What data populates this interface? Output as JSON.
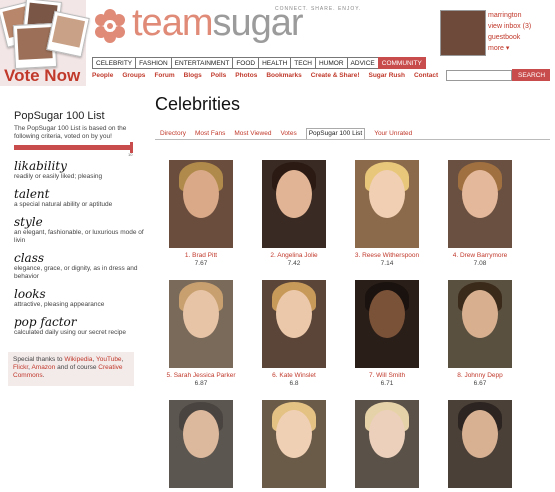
{
  "header": {
    "logo_prefix": "team",
    "logo_suffix": "sugar",
    "tagline": "CONNECT. SHARE. ENJOY.",
    "vote_now": "Vote Now",
    "categories": [
      "CELEBRITY",
      "FASHION",
      "ENTERTAINMENT",
      "FOOD",
      "HEALTH",
      "TECH",
      "HUMOR",
      "ADVICE",
      "COMMUNITY"
    ],
    "active_category": "COMMUNITY",
    "subnav": [
      "People",
      "Groups",
      "Forum",
      "Blogs",
      "Polls",
      "Photos",
      "Bookmarks",
      "Create & Share!",
      "Sugar Rush",
      "Contact"
    ],
    "user": {
      "username": "marrington",
      "inbox": "view inbox (3)",
      "guestbook": "guestbook",
      "more": "more ▾"
    },
    "search": {
      "button": "SEARCH",
      "value": ""
    }
  },
  "sidebar": {
    "title": "PopSugar 100 List",
    "description": "The PopSugar 100 List is based on the following criteria, voted on by you!",
    "slider_label": "10",
    "criteria": [
      {
        "title": "likability",
        "desc": "readily or easily liked; pleasing"
      },
      {
        "title": "talent",
        "desc": "a special natural ability or aptitude"
      },
      {
        "title": "style",
        "desc": "an elegant, fashionable, or luxurious mode of livin"
      },
      {
        "title": "class",
        "desc": "elegance, grace, or dignity, as in dress and behavior"
      },
      {
        "title": "looks",
        "desc": "attractive, pleasing appearance"
      },
      {
        "title": "pop factor",
        "desc": "calculated daily using our secret recipe"
      }
    ],
    "thanks": {
      "prefix": "Special thanks to ",
      "wikipedia": "Wikipedia",
      "comma1": ", ",
      "youtube": "YouTube",
      "comma2": ", ",
      "flickr": "Flickr",
      "comma3": ", ",
      "amazon": "Amazon",
      "mid": " and of course ",
      "cc": "Creative Commons",
      "end": "."
    }
  },
  "main": {
    "title": "Celebrities",
    "tabs": [
      "Directory",
      "Most Fans",
      "Most Viewed",
      "Votes",
      "PopSugar 100 List",
      "Your Unrated"
    ],
    "active_tab": "PopSugar 100 List",
    "celebs": [
      {
        "name": "1. Brad Pitt",
        "score": "7.67"
      },
      {
        "name": "2. Angelina Jolie",
        "score": "7.42"
      },
      {
        "name": "3. Reese Witherspoon",
        "score": "7.14"
      },
      {
        "name": "4. Drew Barrymore",
        "score": "7.08"
      },
      {
        "name": "5. Sarah Jessica Parker",
        "score": "6.87"
      },
      {
        "name": "6. Kate Winslet",
        "score": "6.8"
      },
      {
        "name": "7. Will Smith",
        "score": "6.71"
      },
      {
        "name": "8. Johnny Depp",
        "score": "6.67"
      },
      {
        "name": "",
        "score": ""
      },
      {
        "name": "",
        "score": ""
      },
      {
        "name": "",
        "score": ""
      },
      {
        "name": "",
        "score": ""
      }
    ]
  },
  "colors": {
    "accent": "#c94c4c",
    "link": "#c0392b",
    "logo": "#e08a78"
  }
}
